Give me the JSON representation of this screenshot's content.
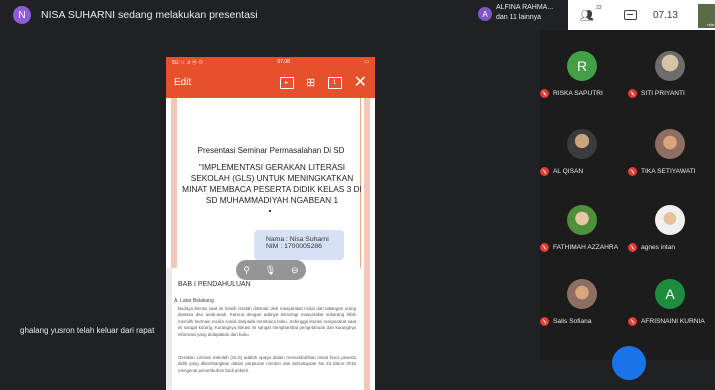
{
  "presenter": {
    "initial": "N",
    "text": "NISA SUHARNI sedang melakukan presentasi"
  },
  "phone": {
    "status_time": "07.08",
    "status_left": "5G ↑↓ .ıl ⓜ ⊙",
    "edit_label": "Edit"
  },
  "slide": {
    "subtitle": "Presentasi Seminar Permasalahan Di SD",
    "title": "\"IMPLEMENTASI GERAKAN LITERASI SEKOLAH (GLS) UNTUK MENINGKATKAN MINAT MEMBACA PESERTA DIDIK KELAS 3 DI SD MUHAMMADIYAH NGABEAN 1",
    "name_line": "Nama : Nisa Suharni",
    "nim_line": "NIM : 1700005286"
  },
  "doc": {
    "heading": "BAB I PENDAHULUAN",
    "subheading": "A. Latar Belakang",
    "para1": "Budaya literasi saat ini masih rendah diminati oleh masyarakat mulai dari kalangan orang dewasa dan anak-anak. Karena dengan adanya teknologi masyarakat sekarang lebih memilih bermain media sosial daripada membaca buku. Sehingga literasi masyarakat saat ini sangat kurang. Kurangnya literasi ini sangat menghambat pengetahuan dan kurangnya informasi yang didapatkan dari buku.",
    "para2": "Gerakan Literasi Sekolah (GLS) adalah upaya dalam menumbuhkan minat baca peserta didik yang dikembangkan dalam peraturan menteri dan kebudayaan No 23 tahun 2015 mengenai penumbuhan budi pekerti."
  },
  "toast": "ghalang yusron telah keluar dari rapat",
  "hand": {
    "initial": "A",
    "line1": "ALFINA RAHMA...",
    "line2": "dan 11 lainnya"
  },
  "info": {
    "people_count": "23",
    "time": "07.13",
    "thumb_label": "nda"
  },
  "participants": [
    {
      "name": "RISKA SAPUTRI",
      "initial": "R",
      "color": "#43a047"
    },
    {
      "name": "SITI PRIYANTI",
      "initial": "",
      "color": ""
    },
    {
      "name": "AL QISAN",
      "initial": "",
      "color": ""
    },
    {
      "name": "TIKA SETIYAWATI",
      "initial": "",
      "color": ""
    },
    {
      "name": "FATHIMAH AZZAHRA",
      "initial": "",
      "color": ""
    },
    {
      "name": "agnes intan",
      "initial": "",
      "color": ""
    },
    {
      "name": "Salis Sofiana",
      "initial": "",
      "color": ""
    },
    {
      "name": "AFRISNAINI KURNIA",
      "initial": "A",
      "color": "#1e8e3e"
    }
  ]
}
